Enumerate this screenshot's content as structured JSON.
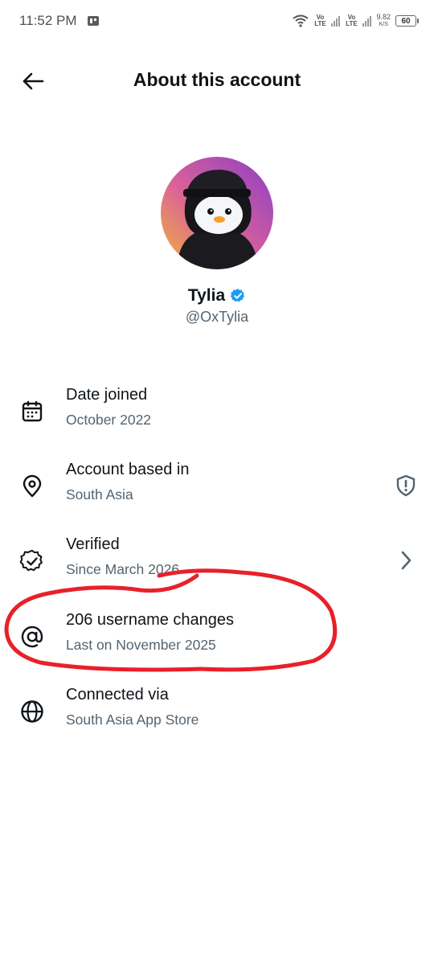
{
  "status_bar": {
    "time": "11:52 PM",
    "network_1": "Vo LTE",
    "network_2": "Vo LTE",
    "speed_value": "9.82",
    "speed_unit": "K/S",
    "battery": "60"
  },
  "header": {
    "title": "About this account",
    "back_icon": "arrow-left-icon"
  },
  "profile": {
    "display_name": "Tylia",
    "handle": "@OxTylia",
    "verified": true,
    "verified_color": "#1d9bf0"
  },
  "info_items": [
    {
      "icon": "calendar-icon",
      "title": "Date joined",
      "subtitle": "October 2022"
    },
    {
      "icon": "location-pin-icon",
      "title": "Account based in",
      "subtitle": "South Asia",
      "action_icon": "shield-alert-icon"
    },
    {
      "icon": "verified-check-icon",
      "title": "Verified",
      "subtitle": "Since March 2026",
      "action_icon": "chevron-right-icon"
    },
    {
      "icon": "at-sign-icon",
      "title": "206 username changes",
      "subtitle": "Last on November 2025"
    },
    {
      "icon": "globe-icon",
      "title": "Connected via",
      "subtitle": "South Asia App Store"
    }
  ],
  "colors": {
    "primary_text": "#0f1419",
    "secondary_text": "#536471",
    "annotation": "#e8202a"
  }
}
